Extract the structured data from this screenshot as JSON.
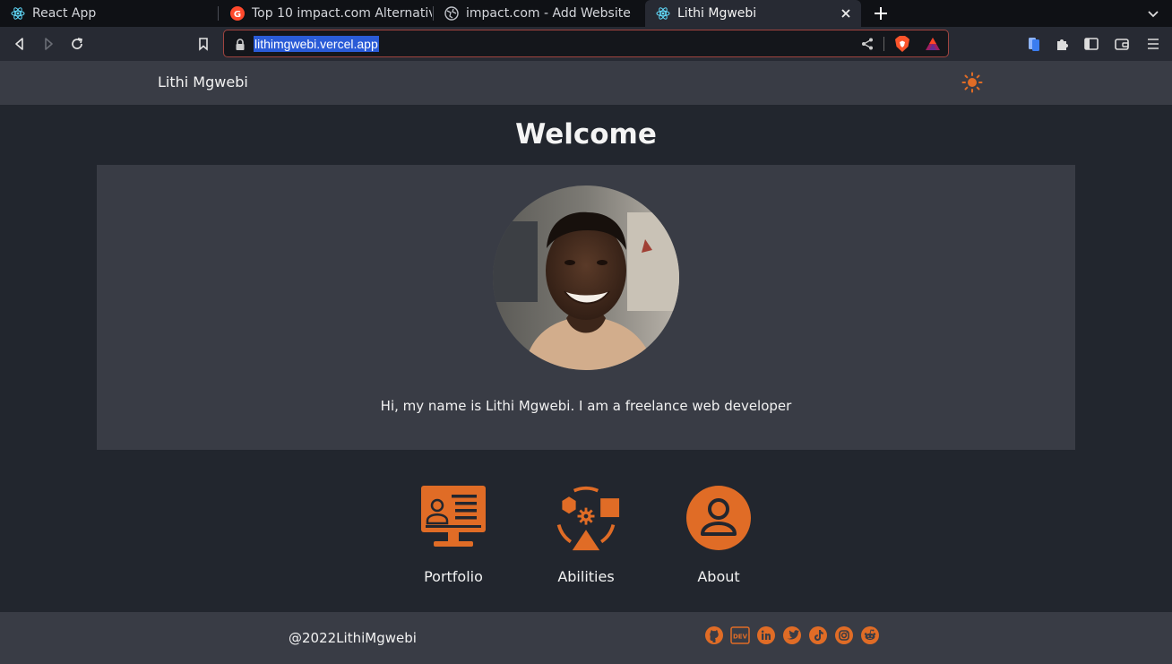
{
  "browser": {
    "tabs": [
      {
        "title": "React App",
        "icon": "react-icon",
        "active": false
      },
      {
        "title": "Top 10 impact.com Alternativ",
        "icon": "g2-icon",
        "active": false
      },
      {
        "title": "impact.com - Add Website",
        "icon": "globe-icon",
        "active": false
      },
      {
        "title": "Lithi Mgwebi",
        "icon": "react-icon",
        "active": true
      }
    ],
    "url": "lithimgwebi.vercel.app"
  },
  "header": {
    "brand": "Lithi Mgwebi",
    "theme_icon": "sun-icon"
  },
  "main": {
    "title": "Welcome",
    "intro": "Hi, my name is Lithi Mgwebi. I am a freelance web developer",
    "nav": [
      {
        "label": "Portfolio",
        "icon": "portfolio-icon"
      },
      {
        "label": "Abilities",
        "icon": "abilities-icon"
      },
      {
        "label": "About",
        "icon": "about-icon"
      }
    ]
  },
  "footer": {
    "copyright": "@2022LithiMgwebi",
    "social": [
      "github-icon",
      "dev-icon",
      "linkedin-icon",
      "twitter-icon",
      "tiktok-icon",
      "instagram-icon",
      "reddit-icon"
    ],
    "dev_text": "DEV"
  },
  "colors": {
    "accent": "#e06c26",
    "page_bg": "#22262e",
    "panel_bg": "#393c45"
  }
}
